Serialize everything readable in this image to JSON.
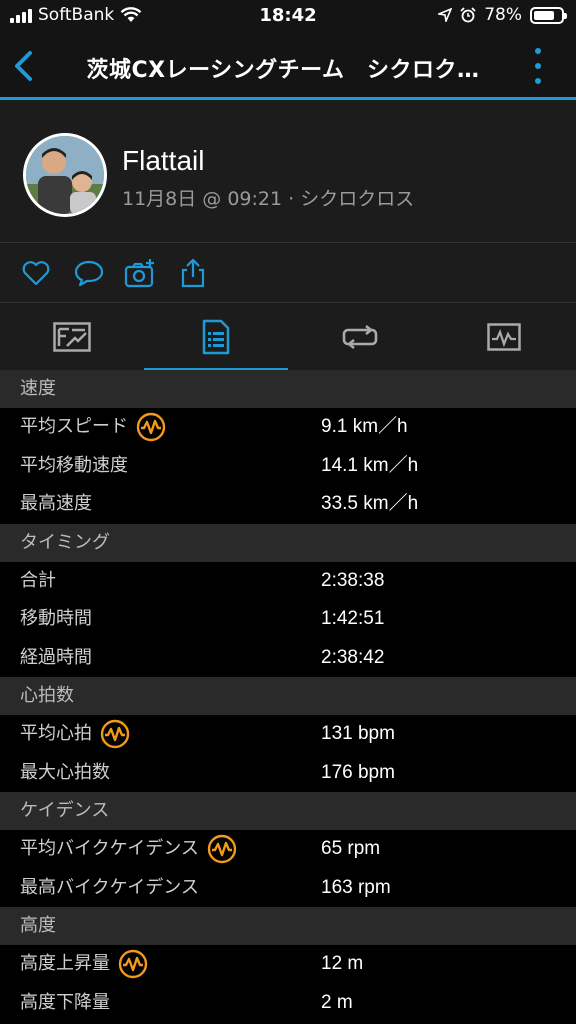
{
  "status_bar": {
    "carrier": "SoftBank",
    "time": "18:42",
    "battery": "78%",
    "battery_level": 0.78
  },
  "nav": {
    "title": "茨城CXレーシングチーム　シクロク…"
  },
  "profile": {
    "name": "Flattail",
    "meta": "11月8日 @ 09:21 · シクロクロス"
  },
  "tabs": [
    "overview",
    "stats",
    "laps",
    "charts"
  ],
  "colors": {
    "accent": "#1e9bd7",
    "badge": "#f29a1a"
  },
  "sections": [
    {
      "title": "速度",
      "rows": [
        {
          "label": "平均スピード",
          "value": "9.1 km／h",
          "badge": true
        },
        {
          "label": "平均移動速度",
          "value": "14.1 km／h",
          "badge": false
        },
        {
          "label": "最高速度",
          "value": "33.5 km／h",
          "badge": false
        }
      ]
    },
    {
      "title": "タイミング",
      "rows": [
        {
          "label": "合計",
          "value": "2:38:38",
          "badge": false
        },
        {
          "label": "移動時間",
          "value": "1:42:51",
          "badge": false
        },
        {
          "label": "経過時間",
          "value": "2:38:42",
          "badge": false
        }
      ]
    },
    {
      "title": "心拍数",
      "rows": [
        {
          "label": "平均心拍",
          "value": "131 bpm",
          "badge": true
        },
        {
          "label": "最大心拍数",
          "value": "176 bpm",
          "badge": false
        }
      ]
    },
    {
      "title": "ケイデンス",
      "rows": [
        {
          "label": "平均バイクケイデンス",
          "value": "65 rpm",
          "badge": true
        },
        {
          "label": "最高バイクケイデンス",
          "value": "163 rpm",
          "badge": false
        }
      ]
    },
    {
      "title": "高度",
      "rows": [
        {
          "label": "高度上昇量",
          "value": "12 m",
          "badge": true
        },
        {
          "label": "高度下降量",
          "value": "2 m",
          "badge": false
        }
      ]
    }
  ]
}
